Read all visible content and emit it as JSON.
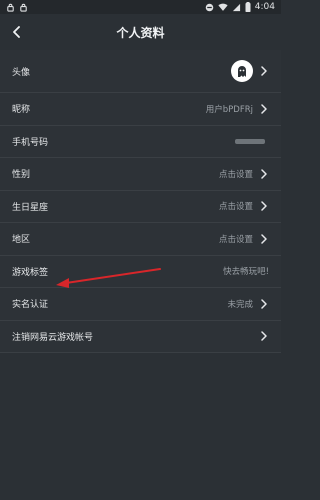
{
  "status_bar": {
    "time": "4:04"
  },
  "header": {
    "title": "个人资料"
  },
  "rows": [
    {
      "label": "头像",
      "value": ""
    },
    {
      "label": "昵称",
      "value": "用户bPDFRj"
    },
    {
      "label": "手机号码",
      "value": ""
    },
    {
      "label": "性别",
      "value": "点击设置"
    },
    {
      "label": "生日星座",
      "value": "点击设置"
    },
    {
      "label": "地区",
      "value": "点击设置"
    },
    {
      "label": "游戏标签",
      "value": "快去畅玩吧!"
    },
    {
      "label": "实名认证",
      "value": "未完成"
    },
    {
      "label": "注销网易云游戏帐号",
      "value": ""
    }
  ],
  "colors": {
    "background": "#2b3035",
    "annotation_arrow": "#d8262a"
  }
}
